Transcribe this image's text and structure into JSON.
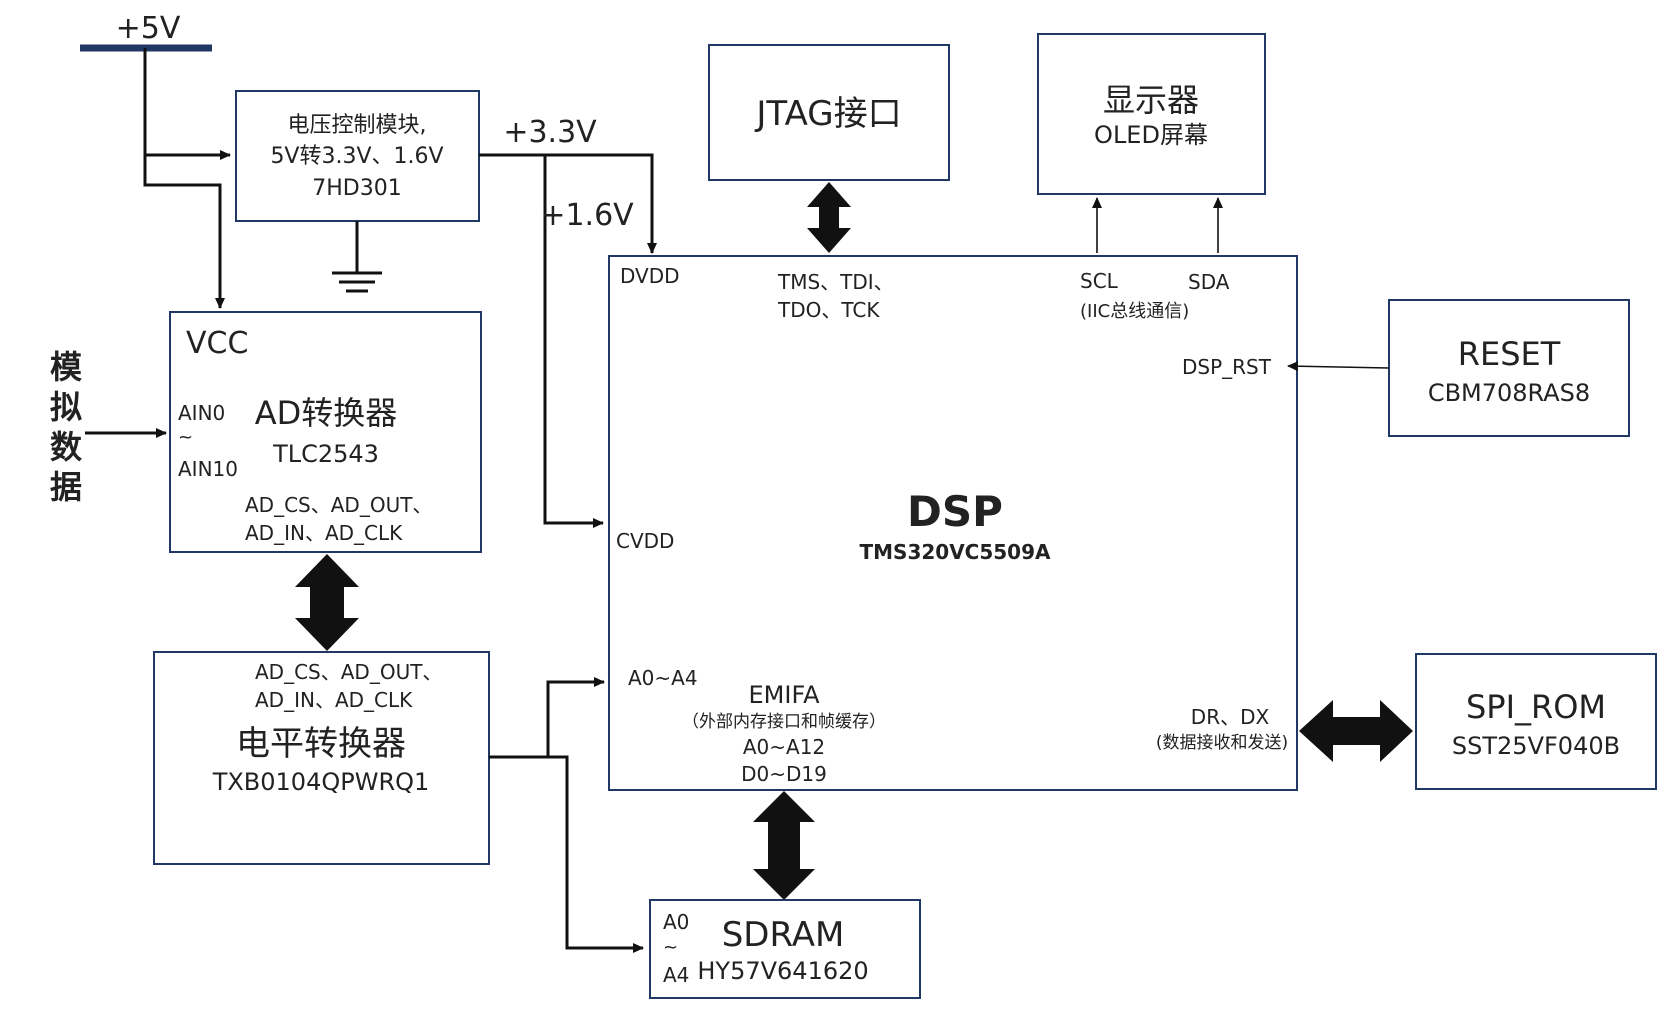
{
  "supply": {
    "v5": "+5V",
    "v33": "+3.3V",
    "v16": "+1.6V"
  },
  "regulator": {
    "line1": "电压控制模块,",
    "line2": "5V转3.3V、1.6V",
    "line3": "7HD301"
  },
  "jtag": {
    "title": "JTAG接口"
  },
  "display": {
    "title": "显示器",
    "subtitle": "OLED屏幕"
  },
  "adc": {
    "vcc": "VCC",
    "ain0": "AIN0",
    "tilde": "~",
    "ain10": "AIN10",
    "title": "AD转换器",
    "part": "TLC2543",
    "pins1": "AD_CS、AD_OUT、",
    "pins2": "AD_IN、AD_CLK"
  },
  "analog_input": {
    "label": "模拟数据"
  },
  "level_shifter": {
    "pins1": "AD_CS、AD_OUT、",
    "pins2": "AD_IN、AD_CLK",
    "title": "电平转换器",
    "part": "TXB0104QPWRQ1"
  },
  "dsp": {
    "title": "DSP",
    "part": "TMS320VC5509A",
    "dvdd": "DVDD",
    "cvdd": "CVDD",
    "jtag_pins1": "TMS、TDI、",
    "jtag_pins2": "TDO、TCK",
    "scl": "SCL",
    "sda": "SDA",
    "i2c": "(IIC总线通信)",
    "dsp_rst": "DSP_RST",
    "a0a4": "A0~A4",
    "emifa": "EMIFA",
    "emifa_desc": "（外部内存接口和帧缓存）",
    "a0a12": "A0~A12",
    "d0d19": "D0~D19",
    "drdx": "DR、DX",
    "drdx_desc": "(数据接收和发送)"
  },
  "reset": {
    "title": "RESET",
    "part": "CBM708RAS8"
  },
  "spi_rom": {
    "title": "SPI_ROM",
    "part": "SST25VF040B"
  },
  "sdram": {
    "a0": "A0",
    "tilde": "~",
    "a4": "A4",
    "title": "SDRAM",
    "part": "HY57V641620"
  },
  "colors": {
    "box_border": "#1f3864",
    "wire": "#111111"
  }
}
